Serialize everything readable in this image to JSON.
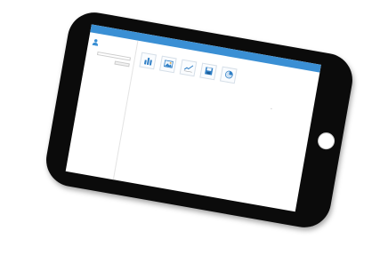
{
  "app": {
    "title": ""
  },
  "sidebar": {
    "user_name": "",
    "user_role": "",
    "search_label": "",
    "search_placeholder": "",
    "search_button": ""
  },
  "main": {
    "section_title": "",
    "tiles": [
      {
        "label": "",
        "icon": "bar-chart-icon"
      },
      {
        "label": "",
        "icon": "image-gallery-icon"
      },
      {
        "label": "",
        "icon": "line-chart-icon"
      },
      {
        "label": "",
        "icon": "save-disk-icon"
      },
      {
        "label": "",
        "icon": "pie-chart-icon"
      }
    ]
  },
  "colors": {
    "accent": "#3a8fd4",
    "device_frame": "#0b0b0b",
    "screen_bg": "#ffffff"
  }
}
